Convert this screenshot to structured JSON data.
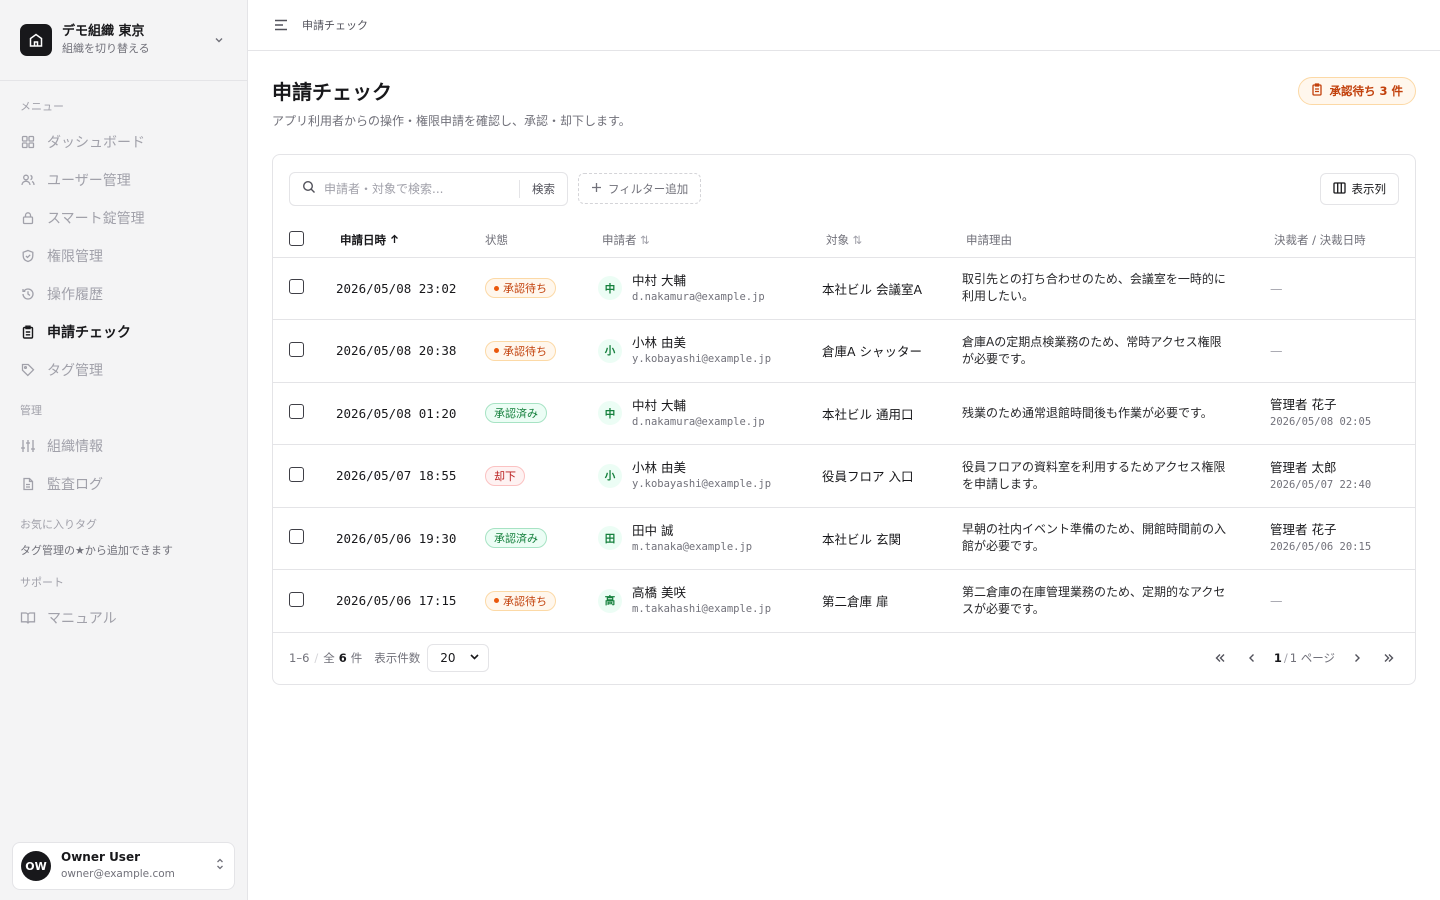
{
  "org": {
    "name": "デモ組織 東京",
    "switch_label": "組織を切り替える"
  },
  "sidebar": {
    "menu_section": "メニュー",
    "menu_items": [
      {
        "label": "ダッシュボード",
        "icon": "grid-icon"
      },
      {
        "label": "ユーザー管理",
        "icon": "users-icon"
      },
      {
        "label": "スマート錠管理",
        "icon": "lock-icon"
      },
      {
        "label": "権限管理",
        "icon": "shield-icon"
      },
      {
        "label": "操作履歴",
        "icon": "history-icon"
      },
      {
        "label": "申請チェック",
        "icon": "clipboard-icon",
        "active": true
      },
      {
        "label": "タグ管理",
        "icon": "tag-icon"
      }
    ],
    "admin_section": "管理",
    "admin_items": [
      {
        "label": "組織情報",
        "icon": "sliders-icon"
      },
      {
        "label": "監査ログ",
        "icon": "file-icon"
      }
    ],
    "favorites_section": "お気に入りタグ",
    "favorites_note": "タグ管理の★から追加できます",
    "support_section": "サポート",
    "support_items": [
      {
        "label": "マニュアル",
        "icon": "book-icon"
      }
    ]
  },
  "user": {
    "initials": "OW",
    "name": "Owner User",
    "email": "owner@example.com"
  },
  "breadcrumb": "申請チェック",
  "page": {
    "title": "申請チェック",
    "description": "アプリ利用者からの操作・権限申請を確認し、承認・却下します。",
    "pending_badge": "承認待ち 3 件"
  },
  "toolbar": {
    "search_placeholder": "申請者・対象で検索...",
    "search_button": "検索",
    "filter_button": "フィルター追加",
    "columns_button": "表示列"
  },
  "table": {
    "headers": {
      "date": "申請日時",
      "status": "状態",
      "applicant": "申請者",
      "target": "対象",
      "reason": "申請理由",
      "decider": "決裁者 / 決裁日時"
    },
    "rows": [
      {
        "date": "2026/05/08 23:02",
        "status": "承認待ち",
        "status_kind": "pending",
        "initial": "中",
        "name": "中村 大輔",
        "email": "d.nakamura@example.jp",
        "target": "本社ビル 会議室A",
        "reason": "取引先との打ち合わせのため、会議室を一時的に利用したい。",
        "decider": "—",
        "decided_at": ""
      },
      {
        "date": "2026/05/08 20:38",
        "status": "承認待ち",
        "status_kind": "pending",
        "initial": "小",
        "name": "小林 由美",
        "email": "y.kobayashi@example.jp",
        "target": "倉庫A シャッター",
        "reason": "倉庫Aの定期点検業務のため、常時アクセス権限が必要です。",
        "decider": "—",
        "decided_at": ""
      },
      {
        "date": "2026/05/08 01:20",
        "status": "承認済み",
        "status_kind": "approved",
        "initial": "中",
        "name": "中村 大輔",
        "email": "d.nakamura@example.jp",
        "target": "本社ビル 通用口",
        "reason": "残業のため通常退館時間後も作業が必要です。",
        "decider": "管理者 花子",
        "decided_at": "2026/05/08 02:05"
      },
      {
        "date": "2026/05/07 18:55",
        "status": "却下",
        "status_kind": "rejected",
        "initial": "小",
        "name": "小林 由美",
        "email": "y.kobayashi@example.jp",
        "target": "役員フロア 入口",
        "reason": "役員フロアの資料室を利用するためアクセス権限を申請します。",
        "decider": "管理者 太郎",
        "decided_at": "2026/05/07 22:40"
      },
      {
        "date": "2026/05/06 19:30",
        "status": "承認済み",
        "status_kind": "approved",
        "initial": "田",
        "name": "田中 誠",
        "email": "m.tanaka@example.jp",
        "target": "本社ビル 玄関",
        "reason": "早朝の社内イベント準備のため、開館時間前の入館が必要です。",
        "decider": "管理者 花子",
        "decided_at": "2026/05/06 20:15"
      },
      {
        "date": "2026/05/06 17:15",
        "status": "承認待ち",
        "status_kind": "pending",
        "initial": "高",
        "name": "高橋 美咲",
        "email": "m.takahashi@example.jp",
        "target": "第二倉庫 扉",
        "reason": "第二倉庫の在庫管理業務のため、定期的なアクセスが必要です。",
        "decider": "—",
        "decided_at": ""
      }
    ]
  },
  "footer": {
    "range": "1–6",
    "total_prefix": "全",
    "total": "6",
    "total_suffix": "件",
    "page_size_label": "表示件数",
    "page_size": "20",
    "current_page": "1",
    "total_pages": "1",
    "page_suffix": "ページ"
  }
}
